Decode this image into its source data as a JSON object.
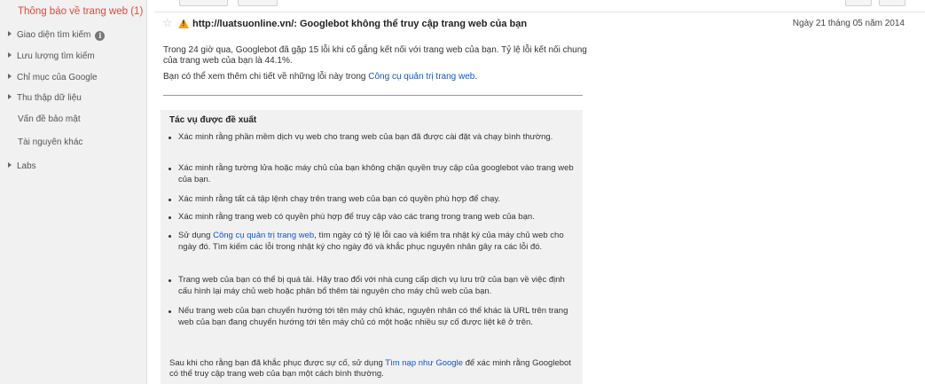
{
  "sidebar": {
    "active": "Thông báo về trang web (1)",
    "items": [
      {
        "label": "Giao diện tìm kiếm",
        "expandable": true,
        "info": true
      },
      {
        "label": "Lưu lượng tìm kiếm",
        "expandable": true
      },
      {
        "label": "Chỉ mục của Google",
        "expandable": true
      },
      {
        "label": "Thu thập dữ liệu",
        "expandable": true
      },
      {
        "label": "Vấn đề bảo mật",
        "expandable": false
      },
      {
        "label": "Tài nguyên khác",
        "expandable": false
      },
      {
        "label": "Labs",
        "expandable": true
      }
    ]
  },
  "message": {
    "title": "http://luatsuonline.vn/: Googlebot không thể truy cập trang web của bạn",
    "date": "Ngày 21 tháng 05 năm 2014",
    "intro": "Trong 24 giờ qua, Googlebot đã gặp 15 lỗi khi cố gắng kết nối với trang web của bạn. Tỷ lệ lỗi kết nối chung của trang web của bạn là 44.1%.",
    "details_prefix": "Bạn có thể xem thêm chi tiết về những lỗi này trong ",
    "details_link": "Công cụ quản trị trang web",
    "details_suffix": "."
  },
  "tasks": {
    "title": "Tác vụ được đề xuất",
    "t1": "Xác minh rằng phần mềm dịch vụ web cho trang web của bạn đã được cài đặt và chạy bình thường.",
    "t2": "Xác minh rằng tường lửa hoặc máy chủ của bạn không chặn quyền truy cập của googlebot vào trang web của bạn.",
    "t3": "Xác minh rằng tất cả tập lệnh chạy trên trang web của bạn có quyền phù hợp để chạy.",
    "t4": "Xác minh rằng trang web có quyền phù hợp để truy cập vào các trang trong trang web của bạn.",
    "t5_prefix": "Sử dụng ",
    "t5_link": "Công cụ quản trị trang web",
    "t5_suffix": ", tìm ngày có tỷ lệ lỗi cao và kiểm tra nhật ký của máy chủ web cho ngày đó. Tìm kiếm các lỗi trong nhật ký cho ngày đó và khắc phục nguyên nhân gây ra các lỗi đó.",
    "t6": "Trang web của bạn có thể bị quá tải. Hãy trao đổi với nhà cung cấp dịch vụ lưu trữ của bạn về việc định cấu hình lại máy chủ web hoặc phân bổ thêm tài nguyên cho máy chủ web của bạn.",
    "t7": "Nếu trang web của bạn chuyển hướng tới tên máy chủ khác, nguyên nhân có thể khác là URL trên trang web của bạn đang chuyển hướng tới tên máy chủ có một hoặc nhiều sự cố được liệt kê ở trên.",
    "closing_prefix": "Sau khi cho rằng bạn đã khắc phục được sự cố, sử dụng ",
    "closing_link": "Tìm nạp như Google",
    "closing_suffix": " để xác minh rằng Googlebot có thể truy cập trang web của bạn một cách bình thường."
  },
  "icons": {
    "star": "star-outline-icon",
    "warning": "warning-triangle-icon",
    "expand": "triangle-right-icon",
    "info": "info-circle-icon"
  },
  "colors": {
    "active_nav": "#dd4b39",
    "link": "#1155cc",
    "warning": "#f3a211"
  }
}
